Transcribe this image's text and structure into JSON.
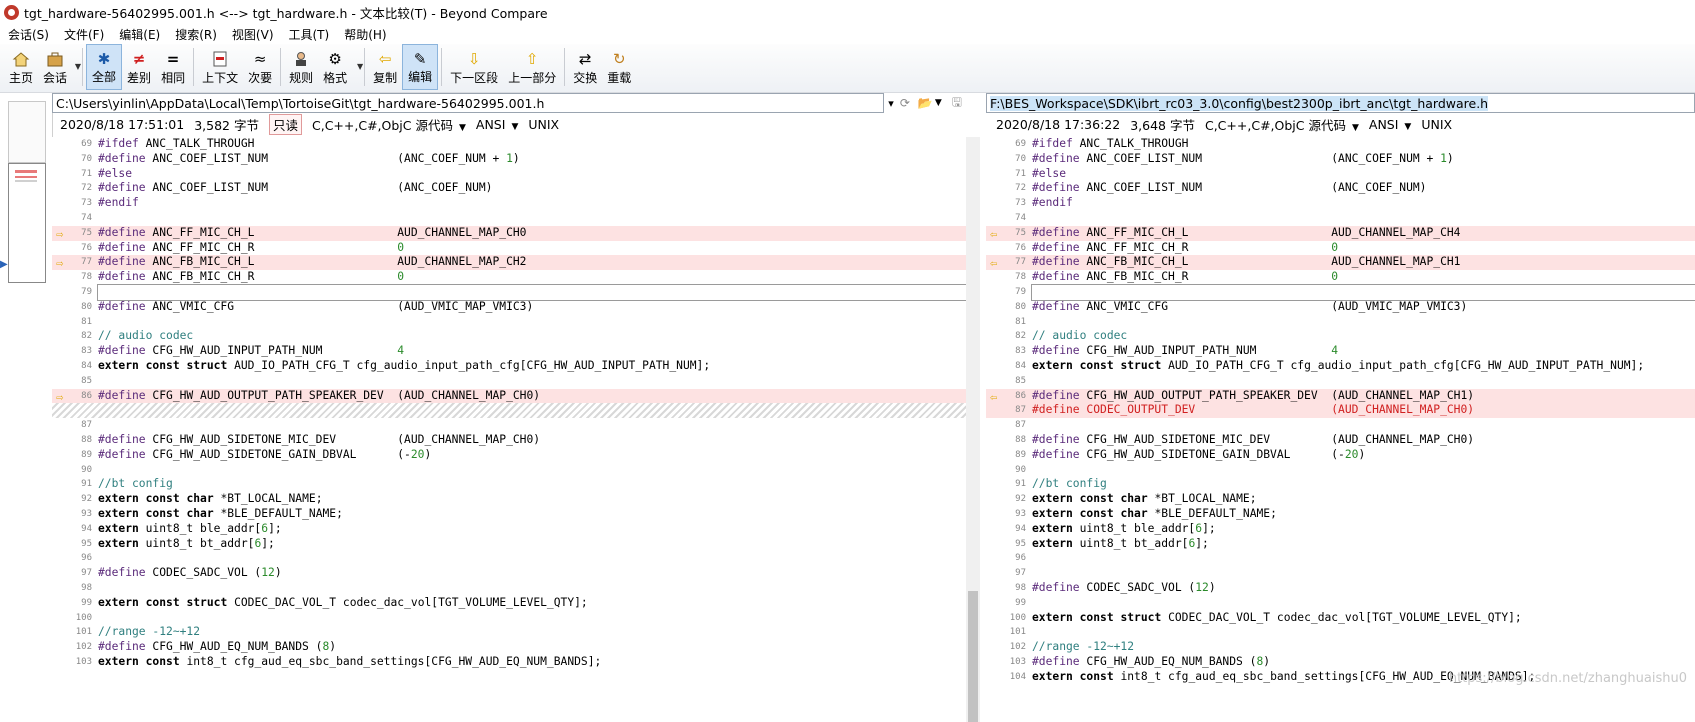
{
  "window": {
    "title": "tgt_hardware-56402995.001.h <--> tgt_hardware.h - 文本比较(T) - Beyond Compare"
  },
  "menu": [
    "会话(S)",
    "文件(F)",
    "编辑(E)",
    "搜索(R)",
    "视图(V)",
    "工具(T)",
    "帮助(H)"
  ],
  "toolbar": {
    "home": "主页",
    "session": "会话",
    "all": "全部",
    "diffs": "差别",
    "same": "相同",
    "context": "上下文",
    "minor": "次要",
    "rules": "规则",
    "format": "格式",
    "copy": "复制",
    "edit": "编辑",
    "next_section": "下一区段",
    "prev_part": "上一部分",
    "swap": "交换",
    "reload": "重载"
  },
  "left": {
    "path": "C:\\Users\\yinlin\\AppData\\Local\\Temp\\TortoiseGit\\tgt_hardware-56402995.001.h",
    "date": "2020/8/18 17:51:01",
    "size": "3,582 字节",
    "readonly": "只读",
    "lang": "C,C++,C#,ObjC 源代码",
    "encoding": "ANSI",
    "eol": "UNIX"
  },
  "right": {
    "path": "F:\\BES_Workspace\\SDK\\ibrt_rc03_3.0\\config\\best2300p_ibrt_anc\\tgt_hardware.h",
    "date": "2020/8/18 17:36:22",
    "size": "3,648 字节",
    "lang": "C,C++,C#,ObjC 源代码",
    "encoding": "ANSI",
    "eol": "UNIX"
  },
  "watermark": "https://blog.csdn.net/zhanghuaishu0",
  "colors": {
    "diff_bg": "#fde2e2",
    "accent": "#cfe3f7",
    "diff_text": "#d02020"
  },
  "left_lines": [
    {
      "n": "69",
      "t": "#ifdef ANC_TALK_THROUGH"
    },
    {
      "n": "70",
      "t": "#define ANC_COEF_LIST_NUM                   (ANC_COEF_NUM + 1)"
    },
    {
      "n": "71",
      "t": "#else"
    },
    {
      "n": "72",
      "t": "#define ANC_COEF_LIST_NUM                   (ANC_COEF_NUM)"
    },
    {
      "n": "73",
      "t": "#endif"
    },
    {
      "n": "74",
      "t": ""
    },
    {
      "n": "75",
      "t": "#define ANC_FF_MIC_CH_L                     AUD_CHANNEL_MAP_CH0",
      "d": true
    },
    {
      "n": "76",
      "t": "#define ANC_FF_MIC_CH_R                     0"
    },
    {
      "n": "77",
      "t": "#define ANC_FB_MIC_CH_L                     AUD_CHANNEL_MAP_CH2",
      "d": true
    },
    {
      "n": "78",
      "t": "#define ANC_FB_MIC_CH_R                     0"
    },
    {
      "n": "79",
      "t": "",
      "c": true
    },
    {
      "n": "80",
      "t": "#define ANC_VMIC_CFG                        (AUD_VMIC_MAP_VMIC3)"
    },
    {
      "n": "81",
      "t": ""
    },
    {
      "n": "82",
      "t": "// audio codec"
    },
    {
      "n": "83",
      "t": "#define CFG_HW_AUD_INPUT_PATH_NUM           4"
    },
    {
      "n": "84",
      "t": "extern const struct AUD_IO_PATH_CFG_T cfg_audio_input_path_cfg[CFG_HW_AUD_INPUT_PATH_NUM];"
    },
    {
      "n": "85",
      "t": ""
    },
    {
      "n": "86",
      "t": "#define CFG_HW_AUD_OUTPUT_PATH_SPEAKER_DEV  (AUD_CHANNEL_MAP_CH0)",
      "d": true
    },
    {
      "n": "",
      "t": "",
      "b": true
    },
    {
      "n": "87",
      "t": ""
    },
    {
      "n": "88",
      "t": "#define CFG_HW_AUD_SIDETONE_MIC_DEV         (AUD_CHANNEL_MAP_CH0)"
    },
    {
      "n": "89",
      "t": "#define CFG_HW_AUD_SIDETONE_GAIN_DBVAL      (-20)"
    },
    {
      "n": "90",
      "t": ""
    },
    {
      "n": "91",
      "t": "//bt config"
    },
    {
      "n": "92",
      "t": "extern const char *BT_LOCAL_NAME;"
    },
    {
      "n": "93",
      "t": "extern const char *BLE_DEFAULT_NAME;"
    },
    {
      "n": "94",
      "t": "extern uint8_t ble_addr[6];"
    },
    {
      "n": "95",
      "t": "extern uint8_t bt_addr[6];"
    },
    {
      "n": "96",
      "t": ""
    },
    {
      "n": "97",
      "t": "#define CODEC_SADC_VOL (12)"
    },
    {
      "n": "98",
      "t": ""
    },
    {
      "n": "99",
      "t": "extern const struct CODEC_DAC_VOL_T codec_dac_vol[TGT_VOLUME_LEVEL_QTY];"
    },
    {
      "n": "100",
      "t": ""
    },
    {
      "n": "101",
      "t": "//range -12~+12"
    },
    {
      "n": "102",
      "t": "#define CFG_HW_AUD_EQ_NUM_BANDS (8)"
    },
    {
      "n": "103",
      "t": "extern const int8_t cfg_aud_eq_sbc_band_settings[CFG_HW_AUD_EQ_NUM_BANDS];"
    }
  ],
  "right_lines": [
    {
      "n": "69",
      "t": "#ifdef ANC_TALK_THROUGH"
    },
    {
      "n": "70",
      "t": "#define ANC_COEF_LIST_NUM                   (ANC_COEF_NUM + 1)"
    },
    {
      "n": "71",
      "t": "#else"
    },
    {
      "n": "72",
      "t": "#define ANC_COEF_LIST_NUM                   (ANC_COEF_NUM)"
    },
    {
      "n": "73",
      "t": "#endif"
    },
    {
      "n": "74",
      "t": ""
    },
    {
      "n": "75",
      "t": "#define ANC_FF_MIC_CH_L                     AUD_CHANNEL_MAP_CH4",
      "d": true
    },
    {
      "n": "76",
      "t": "#define ANC_FF_MIC_CH_R                     0"
    },
    {
      "n": "77",
      "t": "#define ANC_FB_MIC_CH_L                     AUD_CHANNEL_MAP_CH1",
      "d": true
    },
    {
      "n": "78",
      "t": "#define ANC_FB_MIC_CH_R                     0"
    },
    {
      "n": "79",
      "t": "",
      "c": true
    },
    {
      "n": "80",
      "t": "#define ANC_VMIC_CFG                        (AUD_VMIC_MAP_VMIC3)"
    },
    {
      "n": "81",
      "t": ""
    },
    {
      "n": "82",
      "t": "// audio codec"
    },
    {
      "n": "83",
      "t": "#define CFG_HW_AUD_INPUT_PATH_NUM           4"
    },
    {
      "n": "84",
      "t": "extern const struct AUD_IO_PATH_CFG_T cfg_audio_input_path_cfg[CFG_HW_AUD_INPUT_PATH_NUM];"
    },
    {
      "n": "85",
      "t": ""
    },
    {
      "n": "86",
      "t": "#define CFG_HW_AUD_OUTPUT_PATH_SPEAKER_DEV  (AUD_CHANNEL_MAP_CH1)",
      "d": true
    },
    {
      "n": "87",
      "t": "#define CODEC_OUTPUT_DEV                    (AUD_CHANNEL_MAP_CH0)",
      "d": true,
      "r": true
    },
    {
      "n": "87",
      "t": ""
    },
    {
      "n": "88",
      "t": "#define CFG_HW_AUD_SIDETONE_MIC_DEV         (AUD_CHANNEL_MAP_CH0)"
    },
    {
      "n": "89",
      "t": "#define CFG_HW_AUD_SIDETONE_GAIN_DBVAL      (-20)"
    },
    {
      "n": "90",
      "t": ""
    },
    {
      "n": "91",
      "t": "//bt config"
    },
    {
      "n": "92",
      "t": "extern const char *BT_LOCAL_NAME;"
    },
    {
      "n": "93",
      "t": "extern const char *BLE_DEFAULT_NAME;"
    },
    {
      "n": "94",
      "t": "extern uint8_t ble_addr[6];"
    },
    {
      "n": "95",
      "t": "extern uint8_t bt_addr[6];"
    },
    {
      "n": "96",
      "t": ""
    },
    {
      "n": "97",
      "t": ""
    },
    {
      "n": "98",
      "t": "#define CODEC_SADC_VOL (12)"
    },
    {
      "n": "99",
      "t": ""
    },
    {
      "n": "100",
      "t": "extern const struct CODEC_DAC_VOL_T codec_dac_vol[TGT_VOLUME_LEVEL_QTY];"
    },
    {
      "n": "101",
      "t": ""
    },
    {
      "n": "102",
      "t": "//range -12~+12"
    },
    {
      "n": "103",
      "t": "#define CFG_HW_AUD_EQ_NUM_BANDS (8)"
    },
    {
      "n": "104",
      "t": "extern const int8_t cfg_aud_eq_sbc_band_settings[CFG_HW_AUD_EQ_NUM_BANDS];"
    }
  ]
}
